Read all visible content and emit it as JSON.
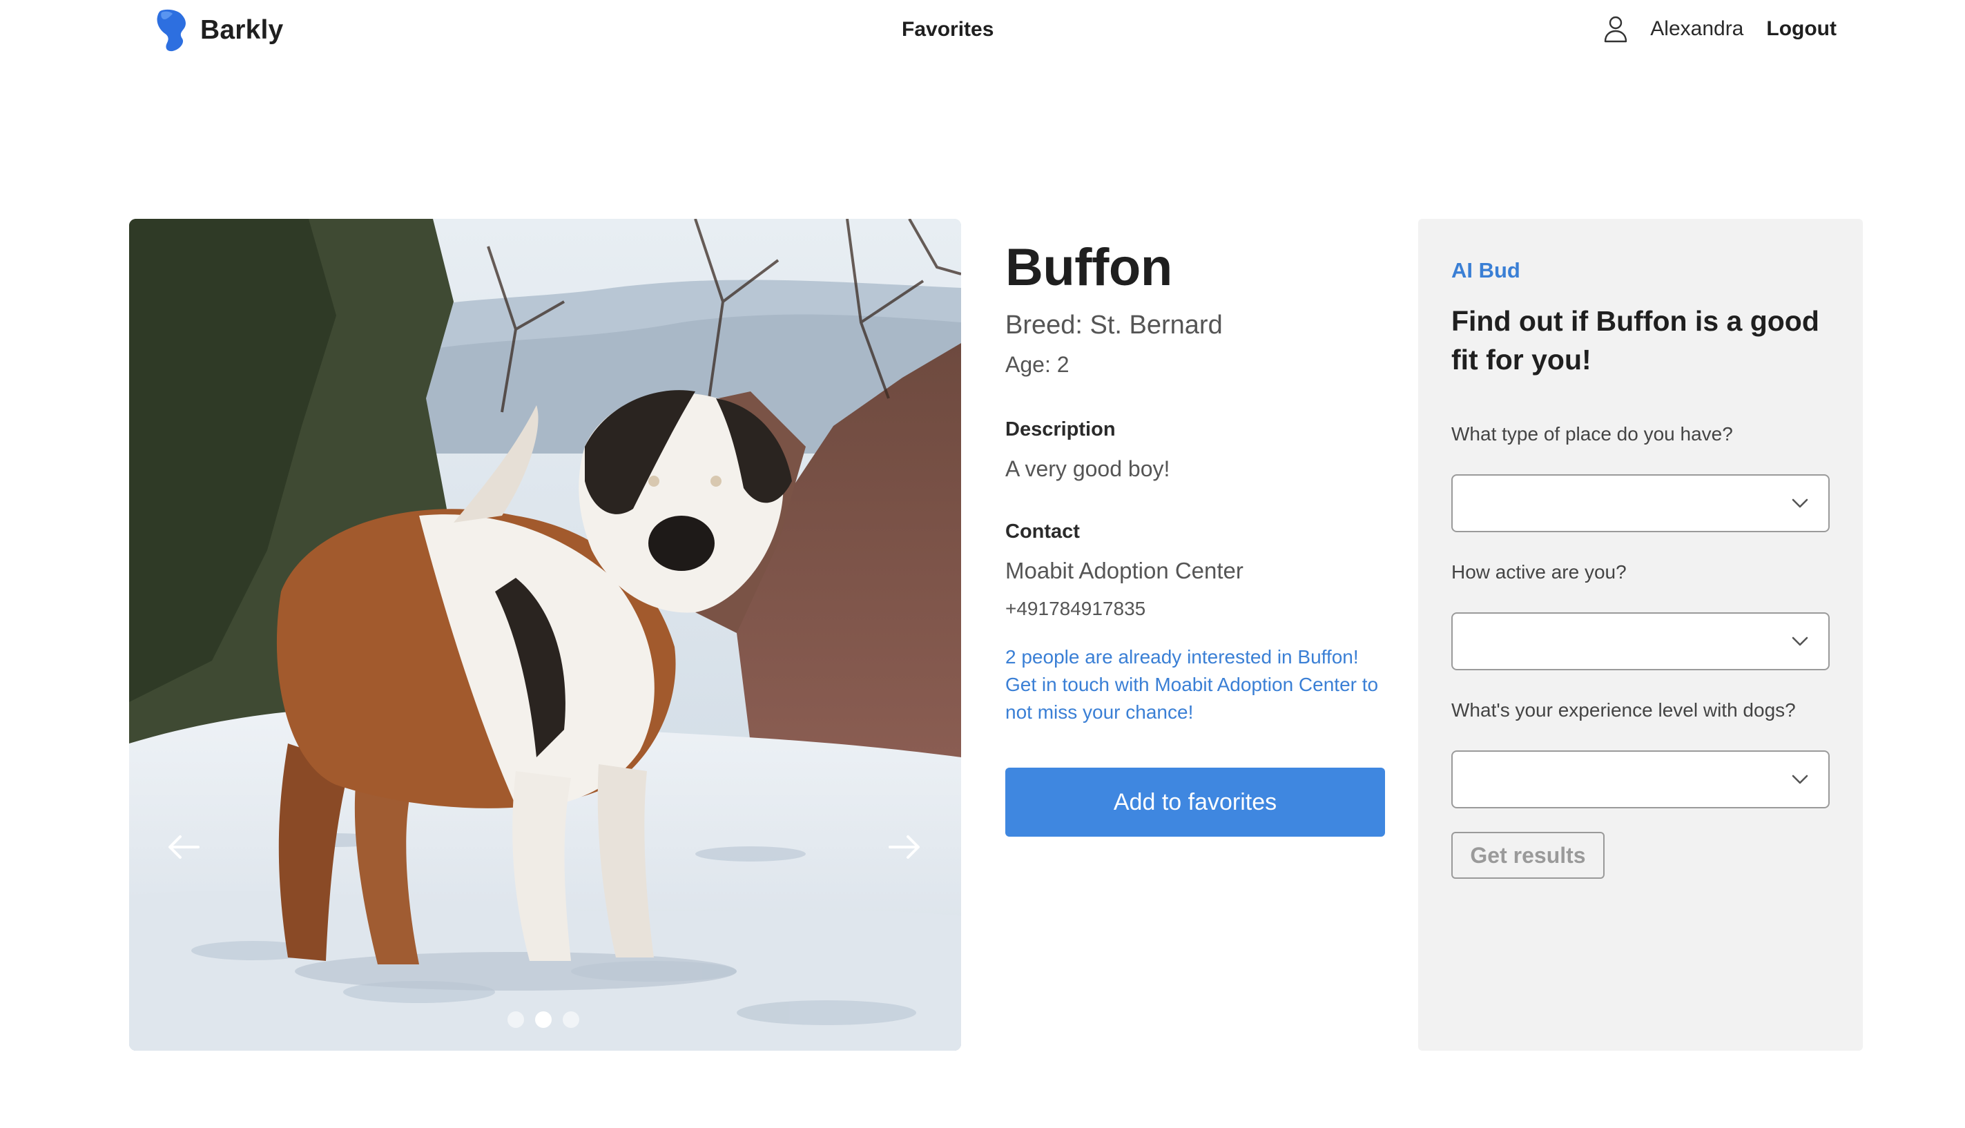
{
  "header": {
    "brand": "Barkly",
    "nav_favorites": "Favorites",
    "user_name": "Alexandra",
    "logout_label": "Logout"
  },
  "carousel": {
    "photo_alt": "St. Bernard dog standing on a snowy path",
    "total_slides": 3,
    "active_slide": 2
  },
  "pet": {
    "name": "Buffon",
    "breed": "Breed: St. Bernard",
    "age": "Age: 2",
    "description_label": "Description",
    "description": "A very good boy!",
    "contact_label": "Contact",
    "contact_center": "Moabit Adoption Center",
    "contact_phone": "+491784917835",
    "interest_note": "2 people are already interested in Buffon! Get in touch with Moabit Adoption Center to not miss your chance!",
    "favorite_button": "Add to favorites"
  },
  "ai": {
    "label": "AI Bud",
    "title": "Find out if Buffon is a good fit for you!",
    "questions": [
      {
        "label": "What type of place do you have?",
        "value": ""
      },
      {
        "label": "How active are you?",
        "value": ""
      },
      {
        "label": "What's your experience level with dogs?",
        "value": ""
      }
    ],
    "submit_label": "Get results"
  },
  "colors": {
    "accent": "#3f87e0",
    "link": "#3a7fd5",
    "panel_bg": "#f2f2f2",
    "text": "#1f1f1f"
  }
}
